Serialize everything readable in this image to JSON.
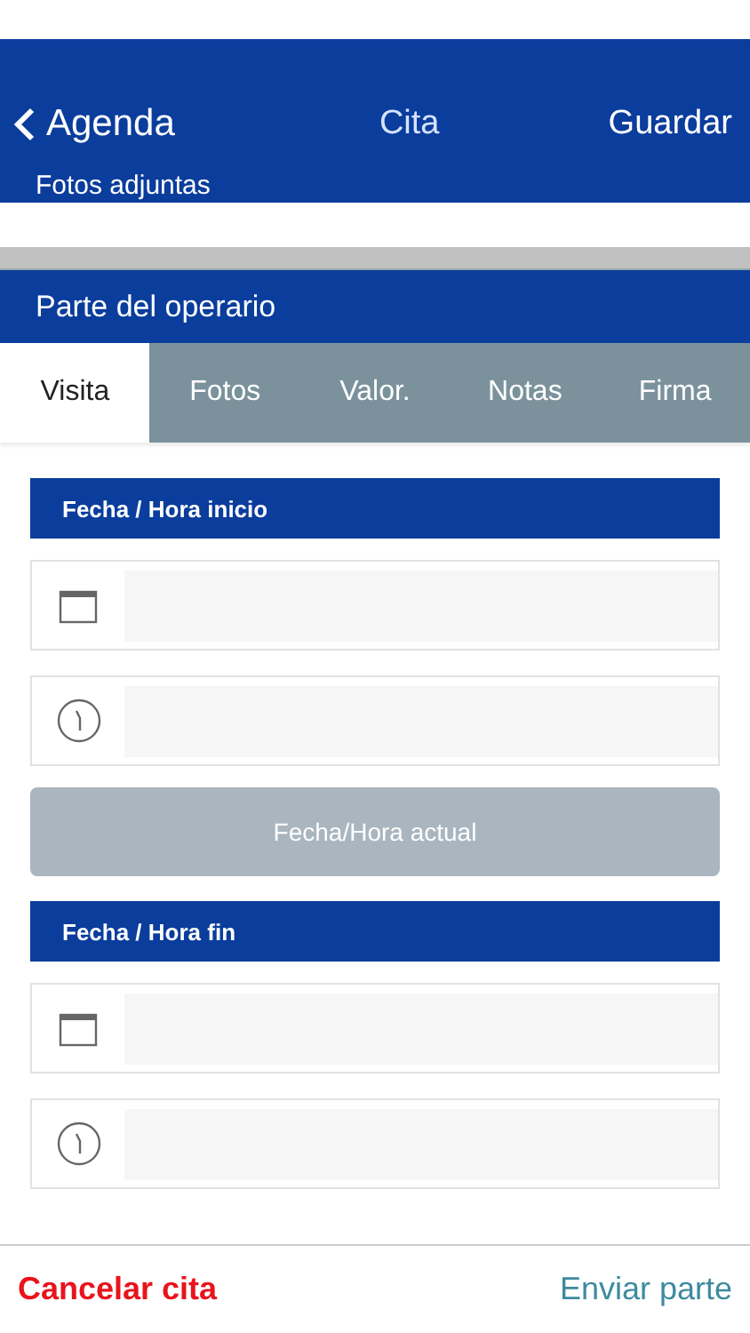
{
  "nav": {
    "back": "Agenda",
    "title": "Cita",
    "action": "Guardar"
  },
  "prev_section": {
    "title": "Fotos adjuntas"
  },
  "section": {
    "title": "Parte del operario"
  },
  "tabs": [
    {
      "label": "Visita",
      "selected": true
    },
    {
      "label": "Fotos",
      "selected": false
    },
    {
      "label": "Valor.",
      "selected": false
    },
    {
      "label": "Notas",
      "selected": false
    },
    {
      "label": "Firma",
      "selected": false
    }
  ],
  "groups": [
    {
      "title": "Fecha / Hora inicio",
      "fields": [
        {
          "kind": "date"
        },
        {
          "kind": "time"
        }
      ],
      "button": {
        "label": "Fecha/Hora actual",
        "disabled": true
      }
    },
    {
      "title": "Fecha / Hora fin",
      "fields": [
        {
          "kind": "date"
        },
        {
          "kind": "time"
        }
      ]
    }
  ],
  "footer": {
    "cancel": "Cancelar cita",
    "send": "Enviar parte"
  }
}
